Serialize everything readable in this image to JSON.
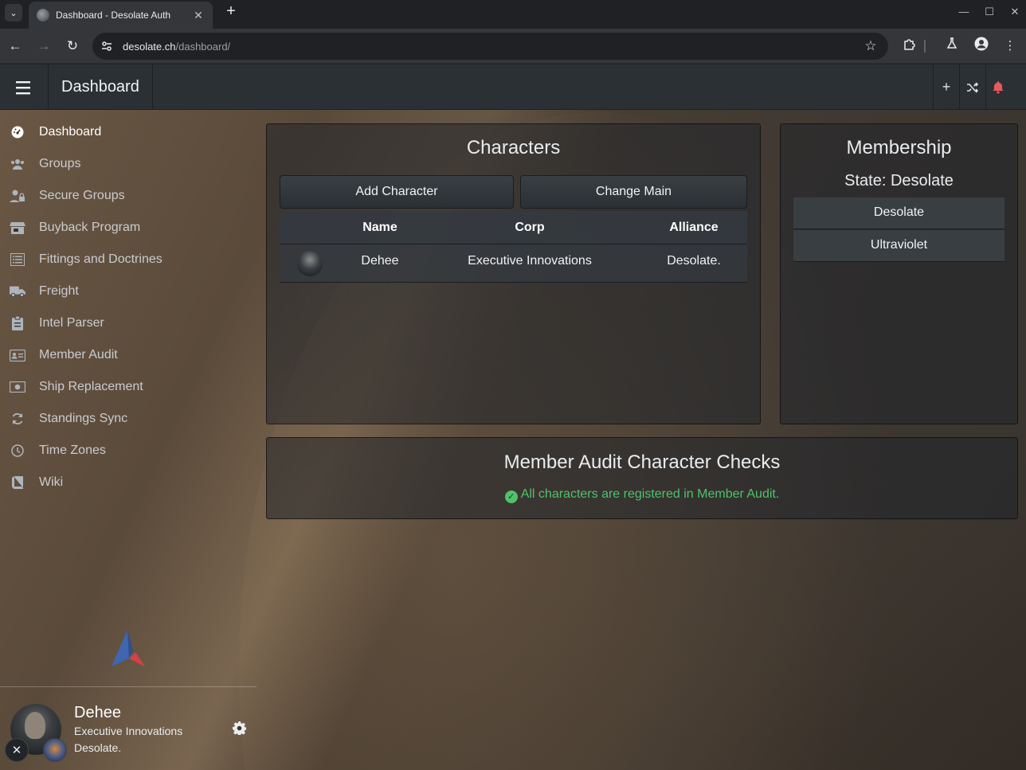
{
  "browser": {
    "tab_title": "Dashboard - Desolate Auth",
    "url_host": "desolate.ch",
    "url_path": "/dashboard/"
  },
  "appbar": {
    "title": "Dashboard"
  },
  "sidebar": {
    "items": [
      {
        "label": "Dashboard",
        "icon": "gauge-icon"
      },
      {
        "label": "Groups",
        "icon": "users-icon"
      },
      {
        "label": "Secure Groups",
        "icon": "user-lock-icon"
      },
      {
        "label": "Buyback Program",
        "icon": "store-icon"
      },
      {
        "label": "Fittings and Doctrines",
        "icon": "list-icon"
      },
      {
        "label": "Freight",
        "icon": "truck-icon"
      },
      {
        "label": "Intel Parser",
        "icon": "clipboard-icon"
      },
      {
        "label": "Member Audit",
        "icon": "id-card-icon"
      },
      {
        "label": "Ship Replacement",
        "icon": "money-icon"
      },
      {
        "label": "Standings Sync",
        "icon": "sync-icon"
      },
      {
        "label": "Time Zones",
        "icon": "clock-icon"
      },
      {
        "label": "Wiki",
        "icon": "book-icon"
      }
    ],
    "user": {
      "name": "Dehee",
      "corp": "Executive Innovations",
      "alliance": "Desolate."
    }
  },
  "characters": {
    "title": "Characters",
    "add_label": "Add Character",
    "change_main_label": "Change Main",
    "columns": [
      "Name",
      "Corp",
      "Alliance"
    ],
    "rows": [
      {
        "name": "Dehee",
        "corp": "Executive Innovations",
        "alliance": "Desolate."
      }
    ]
  },
  "membership": {
    "title": "Membership",
    "state": "State: Desolate",
    "groups": [
      "Desolate",
      "Ultraviolet"
    ]
  },
  "member_audit": {
    "title": "Member Audit Character Checks",
    "message": "All characters are registered in Member Audit."
  },
  "colors": {
    "success": "#4fc26a",
    "notification": "#e85a5a",
    "appbar": "#2b3035"
  }
}
